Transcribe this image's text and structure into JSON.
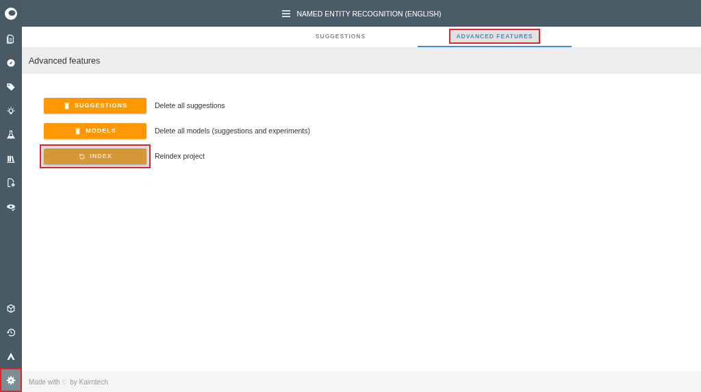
{
  "sidebar": {
    "top_items": [
      {
        "selected": false
      },
      {
        "selected": false
      },
      {
        "selected": false
      },
      {
        "selected": false
      },
      {
        "selected": false
      },
      {
        "selected": false
      },
      {
        "selected": false
      },
      {
        "selected": false
      }
    ],
    "bottom_items": [
      {
        "selected": false,
        "highlighted": false
      },
      {
        "selected": false,
        "highlighted": false
      },
      {
        "selected": false,
        "highlighted": false
      },
      {
        "selected": true,
        "highlighted": true
      }
    ]
  },
  "top_bar": {
    "title": "NAMED ENTITY RECOGNITION (ENGLISH)"
  },
  "tabs": [
    {
      "label": "SUGGESTIONS",
      "selected": false,
      "highlighted": false
    },
    {
      "label": "ADVANCED FEATURES",
      "selected": true,
      "highlighted": true
    }
  ],
  "section": {
    "title": "Advanced features"
  },
  "actions": [
    {
      "kind": "delete",
      "label": "SUGGESTIONS",
      "description": "Delete all suggestions",
      "disabled": false,
      "highlighted": false
    },
    {
      "kind": "delete",
      "label": "MODELS",
      "description": "Delete all models (suggestions and experiments)",
      "disabled": false,
      "highlighted": false
    },
    {
      "kind": "reindex",
      "label": "INDEX",
      "description": "Reindex project",
      "disabled": true,
      "highlighted": true
    }
  ],
  "footer": {
    "text": "Made with ♡ by Kairntech"
  }
}
